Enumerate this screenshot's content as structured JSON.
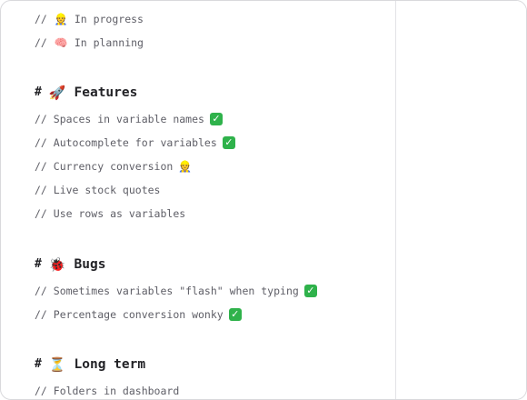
{
  "legend": [
    {
      "prefix": "//",
      "icon": "construction-worker-icon",
      "glyph": "👷",
      "label": "In progress"
    },
    {
      "prefix": "//",
      "icon": "brain-icon",
      "glyph": "🧠",
      "label": "In planning"
    }
  ],
  "sections": [
    {
      "hash": "#",
      "icon": "rocket-icon",
      "glyph": "🚀",
      "title": "Features",
      "items": [
        {
          "text": "// Spaces in variable names",
          "status": "done"
        },
        {
          "text": "// Autocomplete for variables",
          "status": "done"
        },
        {
          "text": "// Currency conversion",
          "status": "in-progress"
        },
        {
          "text": "// Live stock quotes",
          "status": ""
        },
        {
          "text": "// Use rows as variables",
          "status": ""
        }
      ]
    },
    {
      "hash": "#",
      "icon": "lady-beetle-icon",
      "glyph": "🐞",
      "title": "Bugs",
      "items": [
        {
          "text": "// Sometimes variables \"flash\" when typing",
          "status": "done"
        },
        {
          "text": "// Percentage conversion wonky",
          "status": "done"
        }
      ]
    },
    {
      "hash": "#",
      "icon": "hourglass-icon",
      "glyph": "⏳",
      "title": "Long term",
      "items": [
        {
          "text": "// Folders in dashboard",
          "status": ""
        }
      ]
    }
  ],
  "status_glyphs": {
    "done": "✓",
    "in-progress": "👷"
  },
  "colors": {
    "check_green": "#2fb24b",
    "comment_text": "#5e5e66",
    "heading_text": "#222226"
  }
}
